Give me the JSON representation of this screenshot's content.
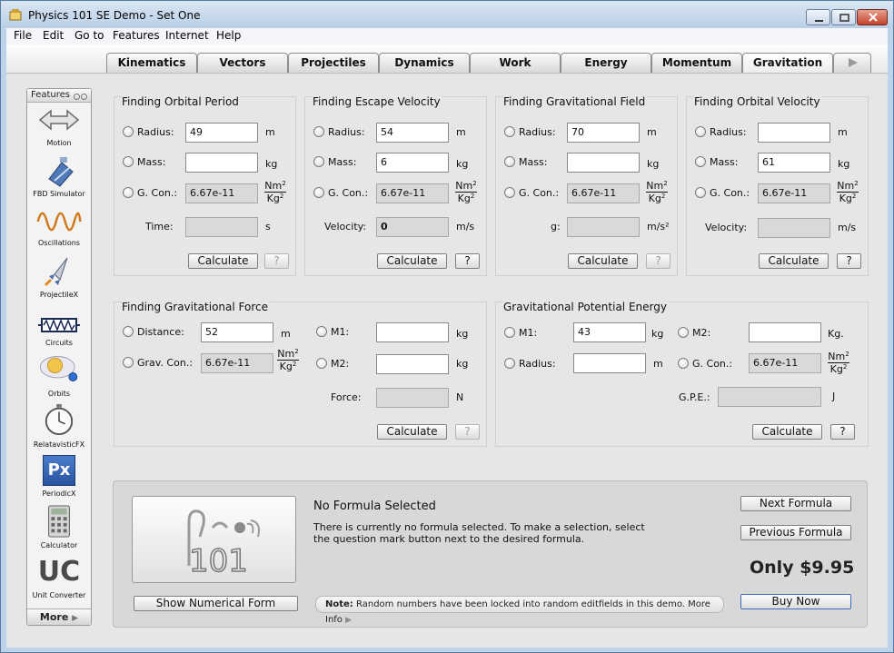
{
  "window": {
    "title": "Physics 101 SE Demo - Set One",
    "icon": "app-icon",
    "buttons": {
      "minimize": "minimize-icon",
      "maximize": "maximize-icon",
      "close": "close-icon"
    }
  },
  "menu": [
    "File",
    "Edit",
    "Go to",
    "Features",
    "Internet",
    "Help"
  ],
  "tabs": [
    {
      "label": "Kinematics"
    },
    {
      "label": "Vectors"
    },
    {
      "label": "Projectiles"
    },
    {
      "label": "Dynamics"
    },
    {
      "label": "Work"
    },
    {
      "label": "Energy"
    },
    {
      "label": "Momentum"
    },
    {
      "label": "Gravitation",
      "active": true
    }
  ],
  "tab_next_icon": "play-arrow-icon",
  "sidebar": {
    "header": "Features",
    "items": [
      {
        "label": "Motion",
        "icon": "double-arrow-icon"
      },
      {
        "label": "FBD Simulator",
        "icon": "block-icon"
      },
      {
        "label": "Oscillations",
        "icon": "wave-icon"
      },
      {
        "label": "ProjectileX",
        "icon": "rocket-icon"
      },
      {
        "label": "Circuits",
        "icon": "resistor-icon"
      },
      {
        "label": "Orbits",
        "icon": "orbit-icon"
      },
      {
        "label": "RelatavisticFX",
        "icon": "stopwatch-icon"
      },
      {
        "label": "PeriodicX",
        "icon": "periodic-icon",
        "text": "Px"
      },
      {
        "label": "Calculator",
        "icon": "calculator-icon"
      },
      {
        "label": "Unit Converter",
        "icon": "uc-icon",
        "text": "UC"
      }
    ],
    "more": "More"
  },
  "panels": {
    "orbital_period": {
      "title": "Finding Orbital Period",
      "radius": {
        "label": "Radius:",
        "value": "49",
        "unit": "m"
      },
      "mass": {
        "label": "Mass:",
        "value": "",
        "unit": "kg"
      },
      "gcon": {
        "label": "G. Con.:",
        "value": "6.67e-11"
      },
      "time": {
        "label": "Time:",
        "value": "",
        "unit": "s"
      },
      "calculate": "Calculate",
      "help": "?"
    },
    "escape_velocity": {
      "title": "Finding Escape Velocity",
      "radius": {
        "label": "Radius:",
        "value": "54",
        "unit": "m"
      },
      "mass": {
        "label": "Mass:",
        "value": "6",
        "unit": "kg"
      },
      "gcon": {
        "label": "G. Con.:",
        "value": "6.67e-11"
      },
      "velocity": {
        "label": "Velocity:",
        "value": "0",
        "unit": "m/s"
      },
      "calculate": "Calculate",
      "help": "?"
    },
    "grav_field": {
      "title": "Finding Gravitational Field",
      "radius": {
        "label": "Radius:",
        "value": "70",
        "unit": "m"
      },
      "mass": {
        "label": "Mass:",
        "value": "",
        "unit": "kg"
      },
      "gcon": {
        "label": "G. Con.:",
        "value": "6.67e-11"
      },
      "g": {
        "label": "g:",
        "value": "",
        "unit": "m/s²"
      },
      "calculate": "Calculate",
      "help": "?"
    },
    "orbital_velocity": {
      "title": "Finding Orbital Velocity",
      "radius": {
        "label": "Radius:",
        "value": "",
        "unit": "m"
      },
      "mass": {
        "label": "Mass:",
        "value": "61",
        "unit": "kg"
      },
      "gcon": {
        "label": "G. Con.:",
        "value": "6.67e-11"
      },
      "velocity": {
        "label": "Velocity:",
        "value": "",
        "unit": "m/s"
      },
      "calculate": "Calculate",
      "help": "?"
    },
    "grav_force": {
      "title": "Finding Gravitational Force",
      "distance": {
        "label": "Distance:",
        "value": "52",
        "unit": "m"
      },
      "gcon": {
        "label": "Grav. Con.:",
        "value": "6.67e-11"
      },
      "m1": {
        "label": "M1:",
        "value": "",
        "unit": "kg"
      },
      "m2": {
        "label": "M2:",
        "value": "",
        "unit": "kg"
      },
      "force": {
        "label": "Force:",
        "value": "",
        "unit": "N"
      },
      "calculate": "Calculate",
      "help": "?"
    },
    "gpe": {
      "title": "Gravitational Potential Energy",
      "m1": {
        "label": "M1:",
        "value": "43",
        "unit": "kg"
      },
      "radius": {
        "label": "Radius:",
        "value": "",
        "unit": "m"
      },
      "m2": {
        "label": "M2:",
        "value": "",
        "unit": "Kg."
      },
      "gcon": {
        "label": "G. Con.:",
        "value": "6.67e-11"
      },
      "gpe": {
        "label": "G.P.E.:",
        "value": "",
        "unit": "J"
      },
      "calculate": "Calculate",
      "help": "?"
    }
  },
  "gcon_unit": {
    "top": "Nm",
    "top_sup": "2",
    "bottom": "Kg",
    "bottom_sup": "2"
  },
  "formula": {
    "title": "No Formula Selected",
    "description": "There is currently no formula selected. To make a selection, select the question mark button next to the desired formula.",
    "show_numerical": "Show Numerical Form",
    "note_label": "Note:",
    "note_text": "Random numbers have been locked into random editfields in this demo. More Info",
    "next": "Next Formula",
    "previous": "Previous Formula",
    "price": "Only $9.95",
    "buy": "Buy Now",
    "logo_text": "101"
  }
}
